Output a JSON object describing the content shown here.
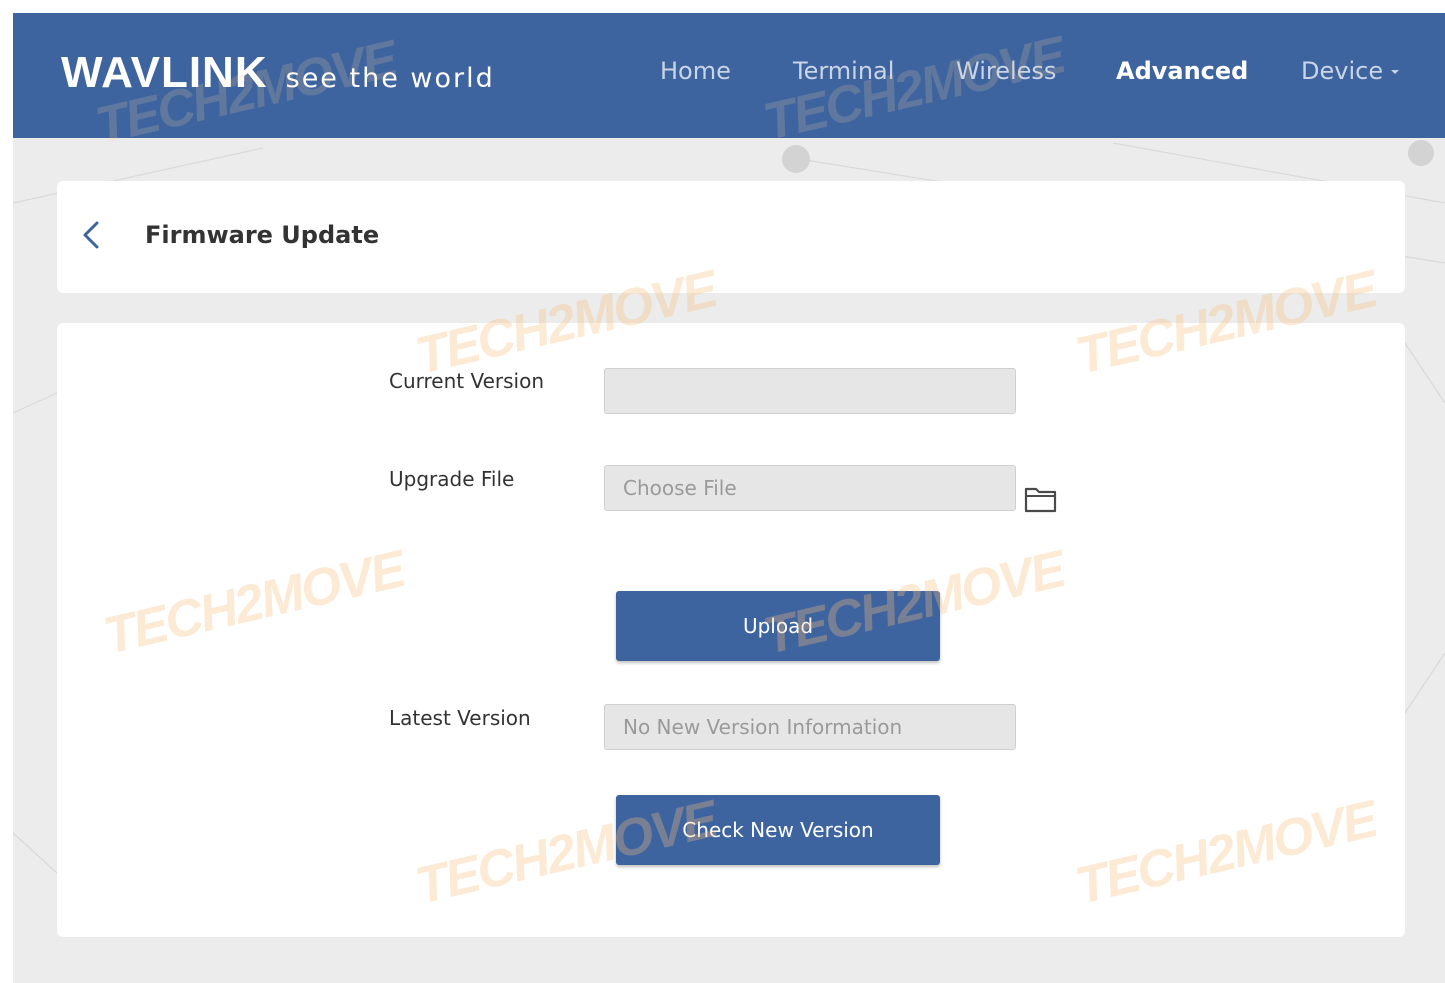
{
  "header": {
    "brand_logo": "WAVLINK",
    "brand_tagline": "see the world",
    "nav": [
      {
        "label": "Home",
        "active": false
      },
      {
        "label": "Terminal",
        "active": false
      },
      {
        "label": "Wireless",
        "active": false
      },
      {
        "label": "Advanced",
        "active": true
      },
      {
        "label": "Device",
        "active": false,
        "has_dropdown": true
      }
    ]
  },
  "page": {
    "back_icon": "chevron-left-icon",
    "title": "Firmware Update"
  },
  "form": {
    "current_version": {
      "label": "Current Version",
      "value": ""
    },
    "upgrade_file": {
      "label": "Upgrade File",
      "placeholder": "Choose File",
      "icon": "folder-icon"
    },
    "upload_button": "Upload",
    "latest_version": {
      "label": "Latest Version",
      "value": "No New Version Information"
    },
    "check_button": "Check New Version"
  },
  "watermark": "TECH2MOVE",
  "colors": {
    "primary": "#3e64a0",
    "page_background": "#ececec",
    "card": "#ffffff",
    "field_background": "#e6e6e6",
    "watermark": "#f5be78"
  }
}
